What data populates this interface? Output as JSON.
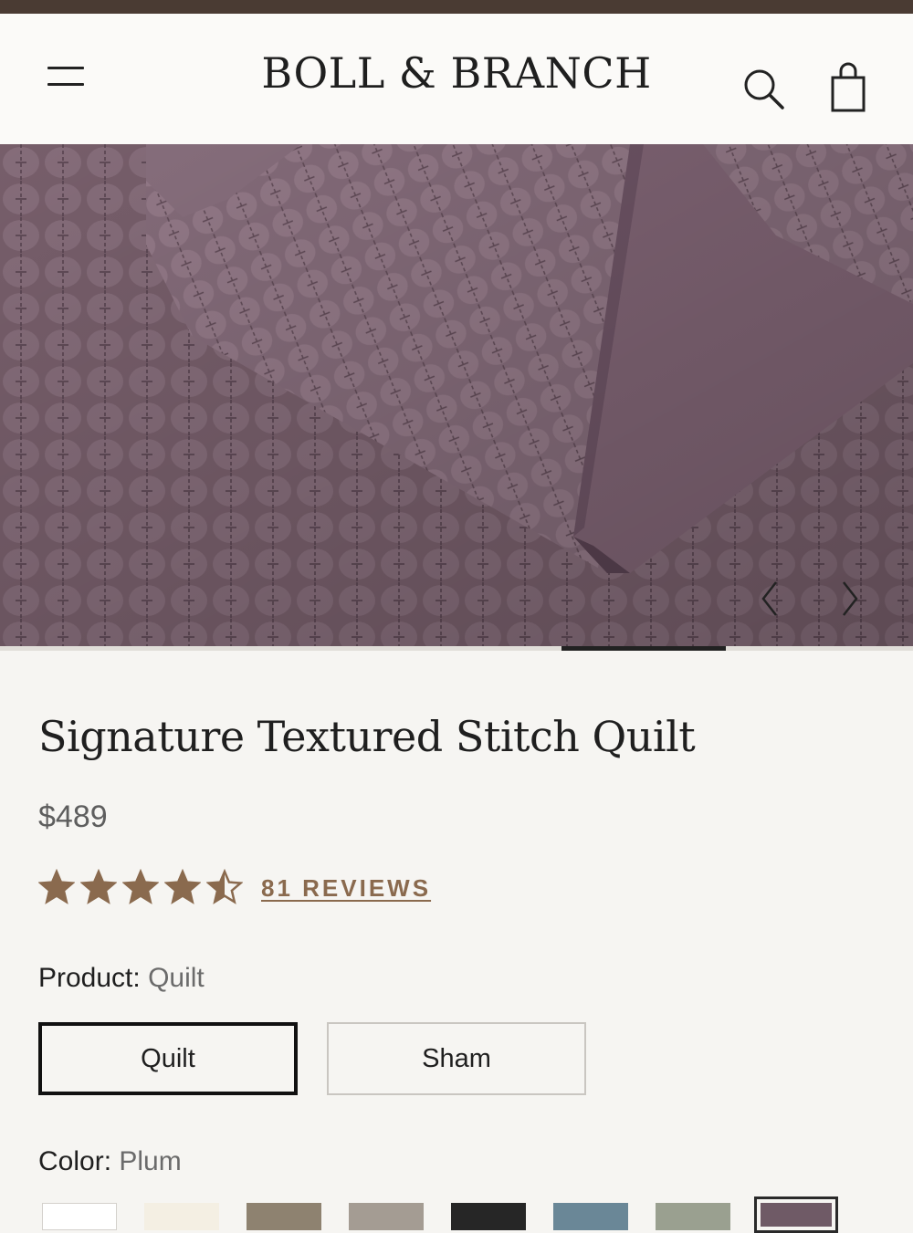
{
  "brand": {
    "name": "BOLL & BRANCH"
  },
  "header": {
    "menu_icon": "hamburger-menu-icon",
    "search_icon": "search-icon",
    "cart_icon": "shopping-bag-icon"
  },
  "gallery": {
    "image_description_icon": "plum-quilt-photo",
    "prev_icon": "chevron-left-icon",
    "next_icon": "chevron-right-icon",
    "progress_fraction": 0.18,
    "progress_index_fraction": 0.615
  },
  "product": {
    "title": "Signature Textured Stitch Quilt",
    "price": "$489",
    "rating": 4.5,
    "rating_max": 5,
    "reviews_link": "81 REVIEWS"
  },
  "product_option": {
    "label": "Product:",
    "value": "Quilt",
    "choices": [
      {
        "label": "Quilt",
        "selected": true
      },
      {
        "label": "Sham",
        "selected": false
      }
    ]
  },
  "color_option": {
    "label": "Color:",
    "value": "Plum",
    "swatches": [
      {
        "color": "#ffffff",
        "selected": false
      },
      {
        "color": "#f4efe3",
        "selected": false
      },
      {
        "color": "#8e8270",
        "selected": false
      },
      {
        "color": "#a49c93",
        "selected": false
      },
      {
        "color": "#262626",
        "selected": false
      },
      {
        "color": "#6a8797",
        "selected": false
      },
      {
        "color": "#9aa090",
        "selected": false
      },
      {
        "color": "#6f5a66",
        "selected": true
      }
    ]
  },
  "colors": {
    "accent": "#8a6a4e",
    "star": "#8a6a4e",
    "top_strip": "#4a3b33",
    "plum_base": "#7f6572"
  }
}
